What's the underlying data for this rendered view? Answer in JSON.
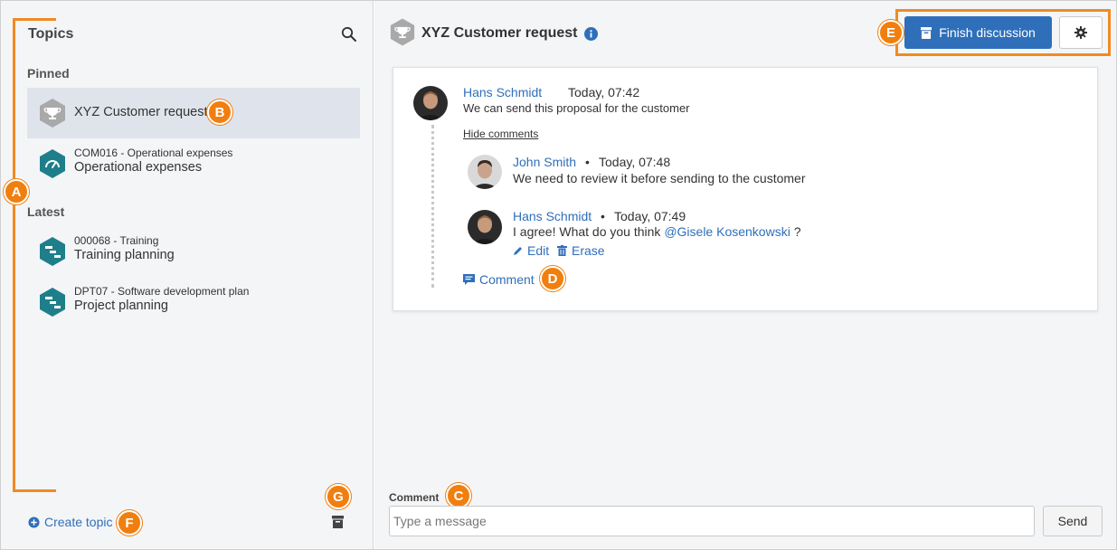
{
  "sidebar": {
    "title": "Topics",
    "pinned_label": "Pinned",
    "latest_label": "Latest",
    "pinned": [
      {
        "title": "XYZ Customer request",
        "icon": "trophy-icon"
      },
      {
        "code": "COM016 - Operational expenses",
        "name": "Operational expenses",
        "icon": "gauge-icon"
      }
    ],
    "latest": [
      {
        "code": "000068 - Training",
        "name": "Training planning",
        "icon": "gantt-icon"
      },
      {
        "code": "DPT07 - Software development plan",
        "name": "Project planning",
        "icon": "gantt-icon"
      }
    ],
    "create_topic_label": "Create topic"
  },
  "header": {
    "title": "XYZ Customer request",
    "finish_label": "Finish discussion"
  },
  "thread": {
    "author": "Hans Schmidt",
    "time": "Today, 07:42",
    "text": "We can send this proposal for the customer",
    "hide_comments_label": "Hide comments",
    "comments": [
      {
        "author": "John Smith",
        "sep": "•",
        "time": "Today, 07:48",
        "text": "We need to review it before sending to the customer"
      },
      {
        "author": "Hans Schmidt",
        "sep": "•",
        "time": "Today, 07:49",
        "text_before": "I agree! What do you think ",
        "mention": "@Gisele Kosenkowski",
        "text_after": " ?",
        "edit_label": "Edit",
        "erase_label": "Erase"
      }
    ],
    "comment_link_label": "Comment"
  },
  "composer": {
    "label": "Comment",
    "placeholder": "Type a message",
    "send_label": "Send"
  },
  "annotations": {
    "a": "A",
    "b": "B",
    "c": "C",
    "d": "D",
    "e": "E",
    "f": "F",
    "g": "G"
  },
  "colors": {
    "accent": "#2f6fba",
    "annotation": "#f07f10",
    "teal_icon": "#1e7f8a",
    "gray_icon": "#a9a9a9"
  }
}
